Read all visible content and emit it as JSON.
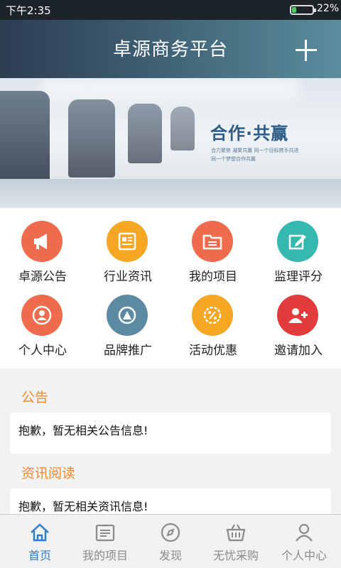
{
  "status_bar": {
    "time": "下午2:35",
    "battery_percent": "22%",
    "battery_level": 0.22
  },
  "header": {
    "title": "卓源商务平台",
    "add_icon": "plus-icon"
  },
  "banner": {
    "slogan": "合作·共赢",
    "sub_line1": "合力聚势 凝聚共赢 同一个目标携手共进",
    "sub_line2": "同一个梦想合作共赢"
  },
  "grid": [
    {
      "label": "卓源公告",
      "icon": "megaphone-icon",
      "color": "#ee6b4d"
    },
    {
      "label": "行业资讯",
      "icon": "newspaper-icon",
      "color": "#f5a623"
    },
    {
      "label": "我的项目",
      "icon": "folder-icon",
      "color": "#ee6b4d"
    },
    {
      "label": "监理评分",
      "icon": "edit-icon",
      "color": "#35b8b0"
    },
    {
      "label": "个人中心",
      "icon": "person-icon",
      "color": "#ee6b4d"
    },
    {
      "label": "品牌推广",
      "icon": "brand-icon",
      "color": "#5b8ba3"
    },
    {
      "label": "活动优惠",
      "icon": "discount-icon",
      "color": "#f5a623"
    },
    {
      "label": "邀请加入",
      "icon": "add-user-icon",
      "color": "#e23b3b"
    }
  ],
  "announcement": {
    "title": "公告",
    "empty_text": "抱歉，暂无相关公告信息!"
  },
  "news": {
    "title": "资讯阅读",
    "empty_text": "抱歉，暂无相关资讯信息!"
  },
  "bottom_nav": [
    {
      "label": "首页",
      "icon": "home-icon",
      "active": true
    },
    {
      "label": "我的项目",
      "icon": "project-icon",
      "active": false
    },
    {
      "label": "发现",
      "icon": "compass-icon",
      "active": false
    },
    {
      "label": "无忧采购",
      "icon": "basket-icon",
      "active": false
    },
    {
      "label": "个人中心",
      "icon": "user-icon",
      "active": false
    }
  ],
  "colors": {
    "accent_orange": "#ef8a2e",
    "nav_active": "#2c7ec7",
    "nav_inactive": "#8a8a8a"
  }
}
